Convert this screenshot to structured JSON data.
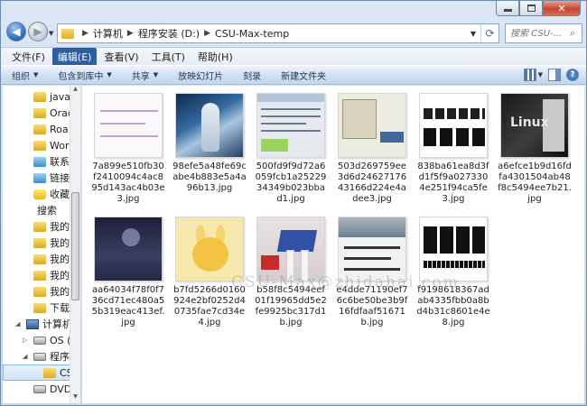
{
  "window": {
    "address": {
      "crumbs": [
        "计算机",
        "程序安装 (D:)",
        "CSU-Max-temp"
      ]
    },
    "search": {
      "placeholder": "搜索 CSU-..."
    }
  },
  "menubar": {
    "items": [
      "文件(F)",
      "编辑(E)",
      "查看(V)",
      "工具(T)",
      "帮助(H)"
    ],
    "active_index": 1
  },
  "toolbar": {
    "items": [
      {
        "label": "组织",
        "caret": true
      },
      {
        "label": "包含到库中",
        "caret": true
      },
      {
        "label": "共享",
        "caret": true
      },
      {
        "label": "放映幻灯片",
        "caret": false
      },
      {
        "label": "刻录",
        "caret": false
      },
      {
        "label": "新建文件夹",
        "caret": false
      }
    ],
    "help_glyph": "?"
  },
  "navpane": {
    "items": [
      {
        "label": "java",
        "icon": "folder"
      },
      {
        "label": "Orac",
        "icon": "folder"
      },
      {
        "label": "Roa",
        "icon": "folder"
      },
      {
        "label": "Wor",
        "icon": "folder"
      },
      {
        "label": "联系",
        "icon": "special"
      },
      {
        "label": "链接",
        "icon": "special"
      },
      {
        "label": "收藏",
        "icon": "star"
      },
      {
        "label": "搜索",
        "icon": "search"
      },
      {
        "label": "我的",
        "icon": "folder"
      },
      {
        "label": "我的",
        "icon": "folder"
      },
      {
        "label": "我的",
        "icon": "folder"
      },
      {
        "label": "我的",
        "icon": "folder"
      },
      {
        "label": "我的",
        "icon": "folder"
      },
      {
        "label": "下载",
        "icon": "folder"
      },
      {
        "label": "计算机",
        "icon": "pc"
      },
      {
        "label": "OS (",
        "icon": "drive"
      },
      {
        "label": "程序",
        "icon": "drive"
      },
      {
        "label": "CS",
        "icon": "folder",
        "selected": true
      },
      {
        "label": "DVD",
        "icon": "drive"
      }
    ]
  },
  "files": [
    {
      "name": "7a899e510fb30f2410094c4ac895d143ac4b03e3.jpg",
      "art": "a1"
    },
    {
      "name": "98efe5a48fe69cabe4b883e5a4a96b13.jpg",
      "art": "a2"
    },
    {
      "name": "500fd9f9d72a6059fcb1a2522934349b023bba d1.jpg",
      "art": "a3"
    },
    {
      "name": "503d269759ee3d6d2462717643166d224e4adee3.jpg",
      "art": "a4"
    },
    {
      "name": "838ba61ea8d3fd1f5f9a0273304e251f94ca5fe3.jpg",
      "art": "a5"
    },
    {
      "name": "a6efce1b9d16fdfa4301504ab48f8c5494ee7b21.jpg",
      "art": "a6"
    },
    {
      "name": "aa64034f78f0f736cd71ec480a55b319eac413ef.jpg",
      "art": "a7"
    },
    {
      "name": "b7fd5266d0160924e2bf0252d40735fae7cd34e4.jpg",
      "art": "a8"
    },
    {
      "name": "b58f8c5494eef01f19965dd5e2fe9925bc317d1b.jpg",
      "art": "a9"
    },
    {
      "name": "e4dde71190ef76c6be50be3b9f16fdfaaf51671b.jpg",
      "art": "a10"
    },
    {
      "name": "f9198618367adab4335fbb0a8bd4b31c8601e4e8.jpg",
      "art": "a11"
    }
  ],
  "watermark": "CSU-Max@zhidahai.com"
}
